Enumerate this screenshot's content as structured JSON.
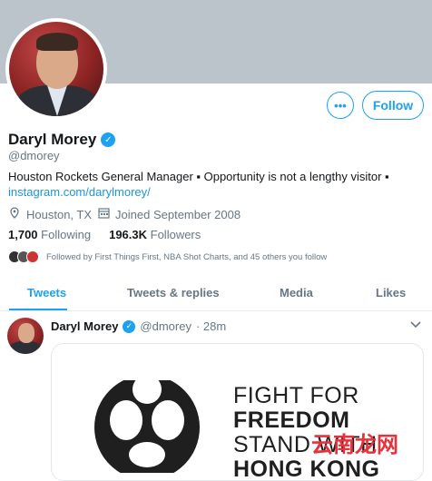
{
  "profile": {
    "name": "Daryl Morey",
    "handle": "@dmorey",
    "bio": "Houston Rockets General Manager ▪ Opportunity is not a lengthy visitor ▪",
    "link": "instagram.com/darylmorey/",
    "location": "Houston, TX",
    "joined": "Joined September 2008",
    "following_count": "1,700",
    "following_label": "Following",
    "followers_count": "196.3K",
    "followers_label": "Followers",
    "followed_by": "Followed by First Things First, NBA Shot Charts, and 45 others you follow"
  },
  "actions": {
    "more_label": "•••",
    "follow_label": "Follow"
  },
  "tabs": [
    {
      "label": "Tweets",
      "active": true
    },
    {
      "label": "Tweets & replies",
      "active": false
    },
    {
      "label": "Media",
      "active": false
    },
    {
      "label": "Likes",
      "active": false
    }
  ],
  "tweet": {
    "author": "Daryl Morey",
    "handle": "@dmorey",
    "time": "· 28m",
    "image_text": {
      "line1": "FIGHT FOR",
      "line2": "FREEDOM",
      "line3": "STAND WITH",
      "line4": "HONG KONG"
    }
  },
  "watermark": "云南龙网",
  "colors": {
    "accent": "#1da1f2",
    "banner": "#bcc4cb",
    "secondary_text": "#657786",
    "watermark": "#e8323b"
  },
  "icons": {
    "verified": "verified-badge-icon",
    "location": "location-pin-icon",
    "calendar": "calendar-icon",
    "caret": "chevron-down-icon"
  }
}
